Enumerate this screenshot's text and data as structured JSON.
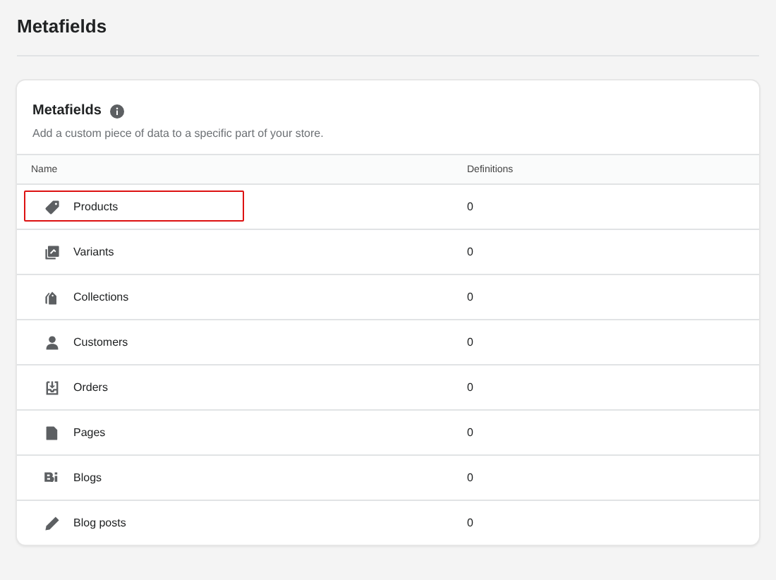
{
  "page_title": "Metafields",
  "card": {
    "title": "Metafields",
    "subtitle": "Add a custom piece of data to a specific part of your store.",
    "table": {
      "columns": [
        "Name",
        "Definitions"
      ],
      "rows": [
        {
          "name": "Products",
          "definitions": "0",
          "highlighted": true
        },
        {
          "name": "Variants",
          "definitions": "0",
          "highlighted": false
        },
        {
          "name": "Collections",
          "definitions": "0",
          "highlighted": false
        },
        {
          "name": "Customers",
          "definitions": "0",
          "highlighted": false
        },
        {
          "name": "Orders",
          "definitions": "0",
          "highlighted": false
        },
        {
          "name": "Pages",
          "definitions": "0",
          "highlighted": false
        },
        {
          "name": "Blogs",
          "definitions": "0",
          "highlighted": false
        },
        {
          "name": "Blog posts",
          "definitions": "0",
          "highlighted": false
        }
      ]
    }
  }
}
